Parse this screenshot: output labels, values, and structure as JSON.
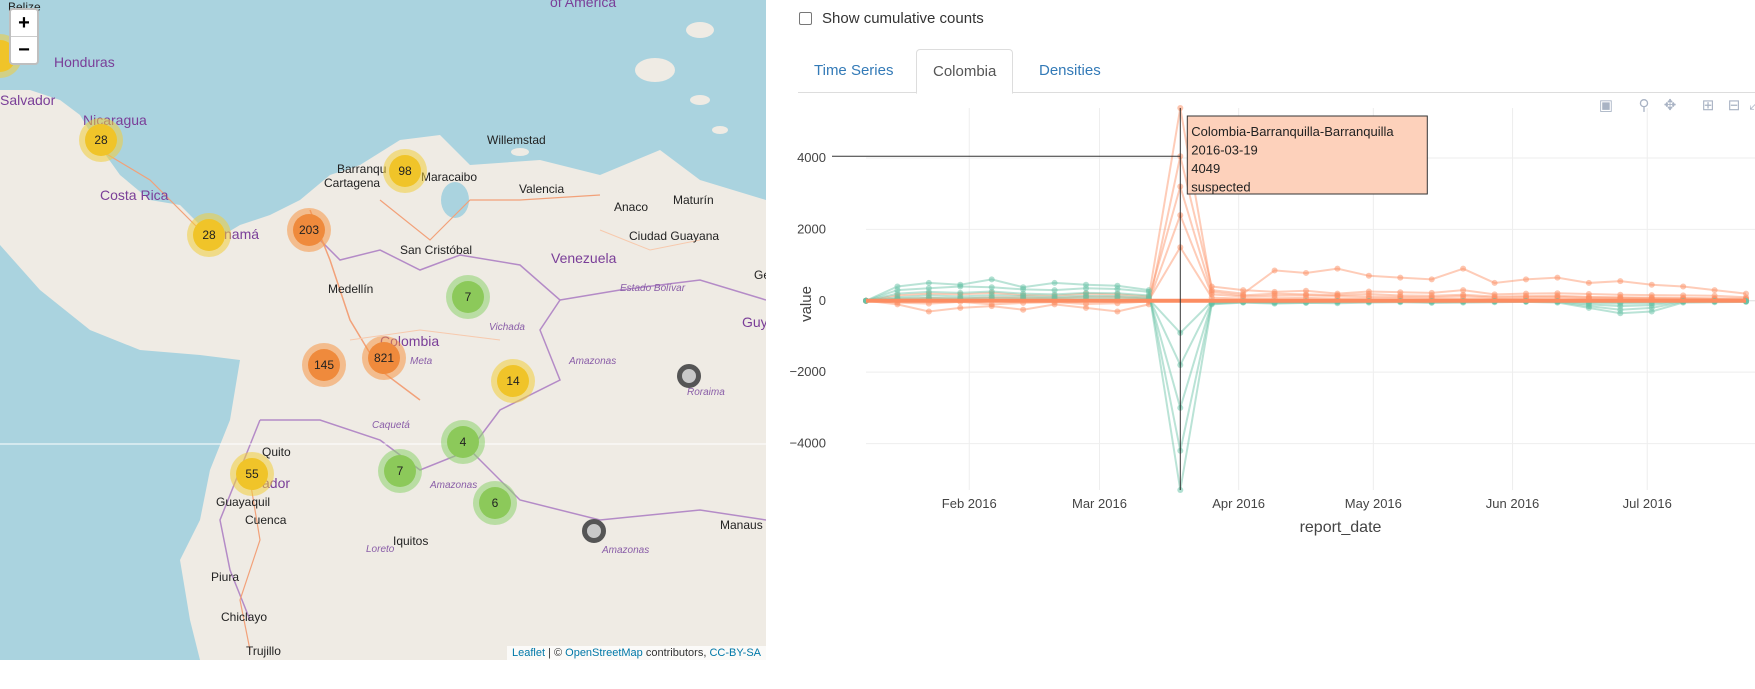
{
  "map": {
    "zoom_in": "+",
    "zoom_out": "−",
    "clusters": [
      {
        "label": "28",
        "level": "yellow"
      },
      {
        "label": "28",
        "level": "yellow"
      },
      {
        "label": "98",
        "level": "yellow"
      },
      {
        "label": "203",
        "level": "orange"
      },
      {
        "label": "7",
        "level": "green"
      },
      {
        "label": "145",
        "level": "orange"
      },
      {
        "label": "821",
        "level": "orange"
      },
      {
        "label": "14",
        "level": "yellow"
      },
      {
        "label": "4",
        "level": "green"
      },
      {
        "label": "7",
        "level": "green"
      },
      {
        "label": "55",
        "level": "yellow"
      },
      {
        "label": "6",
        "level": "green"
      }
    ],
    "place_labels": {
      "belize": "Belize",
      "honduras": "Honduras",
      "salvador": "Salvador",
      "nicaragua": "Nicaragua",
      "costa_rica": "Costa Rica",
      "panama": "namá",
      "barranquilla": "Barranqu",
      "cartagena": "Cartagena",
      "maracaibo": "Maracaibo",
      "willemstad": "Willemstad",
      "valencia": "Valencia",
      "anaco": "Anaco",
      "maturin": "Maturín",
      "ciudad_guayana": "Ciudad Guayana",
      "san_cristobal": "San Cristóbal",
      "venezuela": "Venezuela",
      "estado_bolivar": "Estado Bolívar",
      "medellin": "Medellín",
      "colombia": "Colombia",
      "meta": "Meta",
      "vichada": "Vichada",
      "amazonas_ve": "Amazonas",
      "roraima": "Roraima",
      "caqueta": "Caquetá",
      "quito": "Quito",
      "ecuador": "ador",
      "guayaquil": "Guayaquil",
      "cuenca": "Cuenca",
      "amazonas_co": "Amazonas",
      "iquitos": "Iquitos",
      "loreto": "Loreto",
      "amazonas_br": "Amazonas",
      "manaus": "Manaus",
      "piura": "Piura",
      "chiclayo": "Chiclayo",
      "trujillo": "Trujillo",
      "guy": "Guy",
      "ge": "Ge",
      "america": "of America"
    },
    "attribution": {
      "leaflet": "Leaflet",
      "sep": " | © ",
      "osm": "OpenStreetMap",
      "contributors": " contributors, ",
      "license": "CC-BY-SA"
    }
  },
  "panel": {
    "cumulative_label": "Show cumulative counts",
    "tabs": [
      "Time Series",
      "Colombia",
      "Densities"
    ],
    "active_tab": "Colombia",
    "modebar_icons": [
      "camera-icon",
      "zoom-icon",
      "pan-icon",
      "zoom-in-icon",
      "zoom-out-icon",
      "autoscale-icon"
    ]
  },
  "chart_data": {
    "type": "line",
    "xlabel": "report_date",
    "ylabel": "value",
    "ylim": [
      -5300,
      5400
    ],
    "yticks": [
      4000,
      2000,
      0,
      -2000,
      -4000
    ],
    "xlim": [
      "2016-01-09",
      "2016-07-25"
    ],
    "xticks": [
      {
        "date": "2016-02-01",
        "label": "Feb 2016"
      },
      {
        "date": "2016-03-01",
        "label": "Mar 2016"
      },
      {
        "date": "2016-04-01",
        "label": "Apr 2016"
      },
      {
        "date": "2016-05-01",
        "label": "May 2016"
      },
      {
        "date": "2016-06-01",
        "label": "Jun 2016"
      },
      {
        "date": "2016-07-01",
        "label": "Jul 2016"
      }
    ],
    "grid": true,
    "colors": {
      "suspected": "#fc8d62",
      "confirmed": "#66c2a5"
    },
    "dates": [
      "2016-01-09",
      "2016-01-16",
      "2016-01-23",
      "2016-01-30",
      "2016-02-06",
      "2016-02-13",
      "2016-02-20",
      "2016-02-27",
      "2016-03-05",
      "2016-03-12",
      "2016-03-19",
      "2016-03-26",
      "2016-04-02",
      "2016-04-09",
      "2016-04-16",
      "2016-04-23",
      "2016-04-30",
      "2016-05-07",
      "2016-05-14",
      "2016-05-21",
      "2016-05-28",
      "2016-06-04",
      "2016-06-11",
      "2016-06-18",
      "2016-06-25",
      "2016-07-02",
      "2016-07-09",
      "2016-07-16",
      "2016-07-23"
    ],
    "series": [
      {
        "values": [
          0,
          150,
          200,
          180,
          220,
          160,
          140,
          200,
          180,
          120,
          5400,
          300,
          200,
          850,
          780,
          900,
          700,
          650,
          600,
          900,
          500,
          600,
          650,
          500,
          550,
          450,
          400,
          300,
          200
        ]
      },
      {
        "values": [
          0,
          -100,
          -300,
          -200,
          -150,
          -250,
          -100,
          -200,
          -300,
          -100,
          4049,
          400,
          300,
          250,
          280,
          200,
          260,
          240,
          220,
          300,
          180,
          200,
          210,
          190,
          170,
          160,
          150,
          140,
          100
        ]
      },
      {
        "values": [
          0,
          50,
          80,
          60,
          100,
          90,
          70,
          120,
          110,
          60,
          3200,
          250,
          150,
          200,
          180,
          160,
          190,
          150,
          140,
          170,
          120,
          130,
          140,
          110,
          100,
          90,
          80,
          70,
          60
        ]
      },
      {
        "values": [
          0,
          -50,
          -80,
          -30,
          -100,
          -60,
          -40,
          -90,
          -70,
          -20,
          2400,
          180,
          120,
          140,
          150,
          130,
          120,
          110,
          100,
          130,
          90,
          100,
          110,
          90,
          80,
          70,
          60,
          50,
          40
        ]
      },
      {
        "values": [
          0,
          20,
          30,
          25,
          40,
          30,
          20,
          35,
          30,
          15,
          1500,
          90,
          60,
          70,
          80,
          60,
          70,
          65,
          55,
          60,
          50,
          55,
          60,
          50,
          45,
          40,
          35,
          30,
          25
        ]
      },
      {
        "values": [
          0,
          400,
          500,
          450,
          600,
          380,
          500,
          450,
          420,
          300,
          -5300,
          -100,
          -50,
          -80,
          -60,
          -70,
          -50,
          -40,
          -60,
          -50,
          -40,
          -30,
          -50,
          -200,
          -350,
          -300,
          -50,
          -40,
          -30
        ]
      },
      {
        "values": [
          0,
          300,
          350,
          400,
          380,
          320,
          300,
          350,
          330,
          250,
          -4200,
          -80,
          -40,
          -60,
          -50,
          -40,
          -30,
          -20,
          -40,
          -30,
          -20,
          -20,
          -30,
          -150,
          -250,
          -200,
          -30,
          -20,
          -20
        ]
      },
      {
        "values": [
          0,
          200,
          250,
          220,
          260,
          200,
          180,
          220,
          210,
          150,
          -3000,
          -60,
          -30,
          -40,
          -30,
          -20,
          -20,
          -10,
          -20,
          -20,
          -10,
          -10,
          -20,
          -100,
          -150,
          -120,
          -20,
          -10,
          -10
        ]
      },
      {
        "values": [
          0,
          100,
          150,
          120,
          160,
          130,
          110,
          140,
          130,
          90,
          -1800,
          -40,
          -20,
          -30,
          -20,
          -10,
          -10,
          -10,
          -10,
          -10,
          -10,
          -10,
          -10,
          -60,
          -80,
          -70,
          -10,
          -10,
          -10
        ]
      },
      {
        "values": [
          0,
          60,
          80,
          70,
          90,
          70,
          60,
          80,
          70,
          50,
          -900,
          -20,
          -10,
          -20,
          -10,
          -10,
          -10,
          -10,
          -10,
          -10,
          -10,
          -10,
          -10,
          -30,
          -40,
          -30,
          -10,
          -10,
          -10
        ]
      }
    ],
    "series_colors": [
      "suspected",
      "suspected",
      "suspected",
      "suspected",
      "suspected",
      "confirmed",
      "confirmed",
      "confirmed",
      "confirmed",
      "confirmed"
    ],
    "tooltip": {
      "title": "Colombia-Barranquilla-Barranquilla",
      "date": "2016-03-19",
      "value": "4049",
      "type": "suspected"
    }
  }
}
